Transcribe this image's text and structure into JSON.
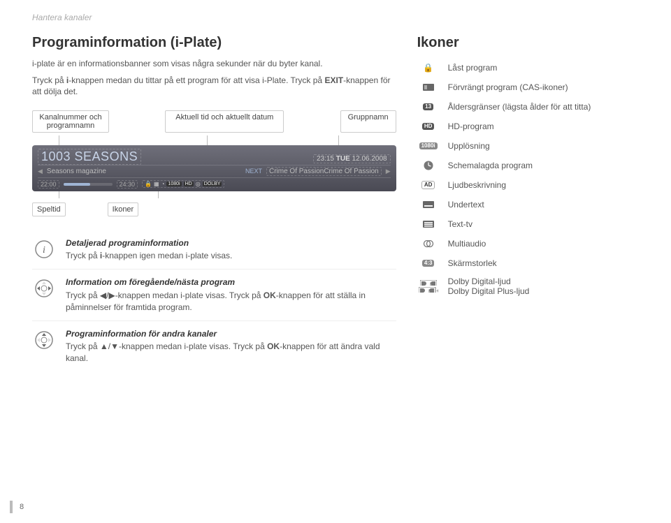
{
  "page_header": "Hantera kanaler",
  "page_number": "8",
  "title": "Programinformation (i-Plate)",
  "intro": {
    "p1": "i-plate är en informationsbanner som visas några sekunder när du byter kanal.",
    "p2a": "Tryck på ",
    "p2_key1": "i",
    "p2b": "-knappen medan du tittar på ett program för att visa i-Plate. Tryck på ",
    "p2_key2": "EXIT",
    "p2c": "-knappen för att dölja det."
  },
  "callouts_top": {
    "c1": "Kanalnummer och programnamn",
    "c2": "Aktuell tid och aktuellt datum",
    "c3": "Gruppnamn"
  },
  "iplate": {
    "channel": "1003 SEASONS",
    "time": "23:15",
    "day": "TUE",
    "date": "12.06.2008",
    "now": "Seasons magazine",
    "next_label": "NEXT",
    "next": "Crime Of PassionCrime Of Passion",
    "start": "22:00",
    "end": "24:30",
    "icons": {
      "res": "1080i",
      "hd": "HD",
      "dolby": "DOLBY"
    }
  },
  "callouts_bot": {
    "c1": "Speltid",
    "c2": "Ikoner"
  },
  "instructions": [
    {
      "title": "Detaljerad programinformation",
      "body_a": "Tryck på ",
      "key": "i",
      "body_b": "-knappen igen medan i-plate visas."
    },
    {
      "title": "Information om föregående/nästa program",
      "body_a": "Tryck på ◀/▶-knappen medan i-plate visas. Tryck på ",
      "key": "OK",
      "body_b": "-knappen för att ställa in påminnelser för framtida program."
    },
    {
      "title": "Programinformation för andra kanaler",
      "body_a": "Tryck på ▲/▼-knappen medan i-plate visas. Tryck på ",
      "key": "OK",
      "body_b": "-knappen för att ändra vald kanal."
    }
  ],
  "right_title": "Ikoner",
  "icon_list": [
    {
      "name": "lock-icon",
      "label": "Låst program"
    },
    {
      "name": "cas-icon",
      "label": "Förvrängt program (CAS-ikoner)"
    },
    {
      "name": "age-icon",
      "label_text": "13",
      "label": "Åldersgränser (lägsta ålder för att titta)"
    },
    {
      "name": "hd-icon",
      "label_text": "HD",
      "label": "HD-program"
    },
    {
      "name": "resolution-icon",
      "label_text": "1080i",
      "label": "Upplösning"
    },
    {
      "name": "schedule-icon",
      "label": "Schemalagda program"
    },
    {
      "name": "ad-icon",
      "label_text": "AD",
      "label": "Ljudbeskrivning"
    },
    {
      "name": "subtitle-icon",
      "label": "Undertext"
    },
    {
      "name": "teletext-icon",
      "label": "Text-tv"
    },
    {
      "name": "multiaudio-icon",
      "label": "Multiaudio"
    },
    {
      "name": "aspect-icon",
      "label_text": "4:3",
      "label": "Skärmstorlek"
    },
    {
      "name": "dolby-icon",
      "label": "Dolby Digital-ljud",
      "label2": "Dolby Digital Plus-ljud"
    }
  ]
}
